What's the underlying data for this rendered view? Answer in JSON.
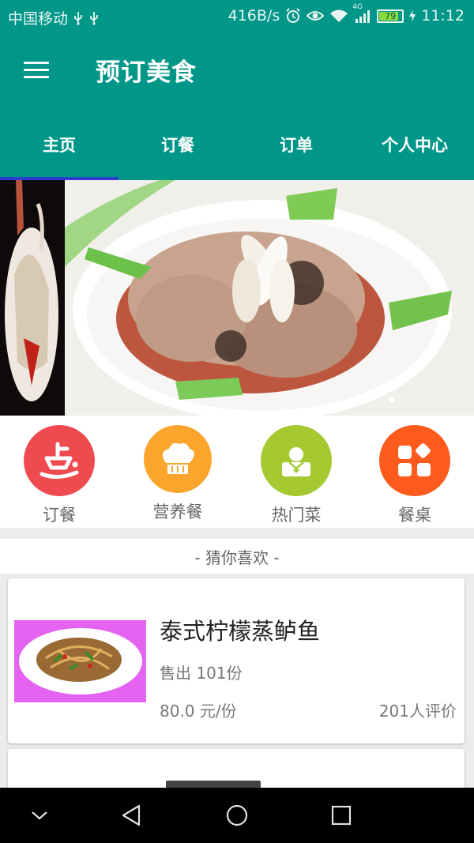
{
  "status_bar": {
    "carrier": "中国移动",
    "network_speed": "416B/s",
    "network_type": "4G",
    "battery": "79",
    "battery_level": 0.79,
    "time": "11:12",
    "icons": [
      "usb-icon",
      "usb-icon",
      "alarm-icon",
      "eye-icon",
      "wifi-icon",
      "signal-icon",
      "battery-icon"
    ]
  },
  "app_bar": {
    "title": "预订美食",
    "menu_icon": "menu-icon"
  },
  "tabs": [
    {
      "label": "主页",
      "active": true
    },
    {
      "label": "订餐",
      "active": false
    },
    {
      "label": "订单",
      "active": false
    },
    {
      "label": "个人中心",
      "active": false
    }
  ],
  "banner": {
    "page_count": 2,
    "current_page": 1
  },
  "categories": [
    {
      "label": "订餐",
      "icon": "order-icon",
      "color": "#ef4a50"
    },
    {
      "label": "营养餐",
      "icon": "chef-hat-icon",
      "color": "#fba52c"
    },
    {
      "label": "热门菜",
      "icon": "person-icon",
      "color": "#a5c931"
    },
    {
      "label": "餐桌",
      "icon": "grid-icon",
      "color": "#fd5a1e"
    }
  ],
  "section": {
    "title": "- 猜你喜欢 -"
  },
  "dishes": [
    {
      "name": "泰式柠檬蒸鲈鱼",
      "sold": "售出 101份",
      "price": "80.0 元/份",
      "reviews": "201人评价"
    }
  ],
  "colors": {
    "primary": "#009688",
    "tab_indicator": "#2f3ccf",
    "background": "#ececec"
  },
  "nav_bar": {
    "icons": [
      "collapse-icon",
      "back-icon",
      "home-icon",
      "recents-icon"
    ]
  }
}
